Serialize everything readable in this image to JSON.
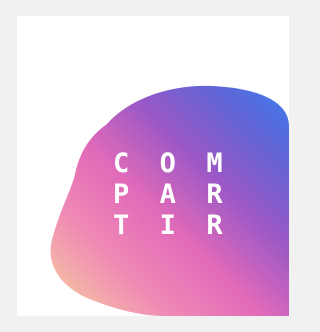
{
  "logo": {
    "row1": "C O M",
    "row2": "P A R",
    "row3": "T I R",
    "letters": {
      "r1": [
        "C",
        "O",
        "M"
      ],
      "r2": [
        "P",
        "A",
        "R"
      ],
      "r3": [
        "T",
        "I",
        "R"
      ]
    }
  },
  "colors": {
    "background": "#f1f1f1",
    "panel": "#ffffff",
    "gradient_left": "#f6c49a",
    "gradient_mid_pink": "#f06bb3",
    "gradient_purple": "#7a4fb8",
    "gradient_right_blue": "#3b7ff0",
    "gradient_cyan": "#5fe9ff"
  }
}
